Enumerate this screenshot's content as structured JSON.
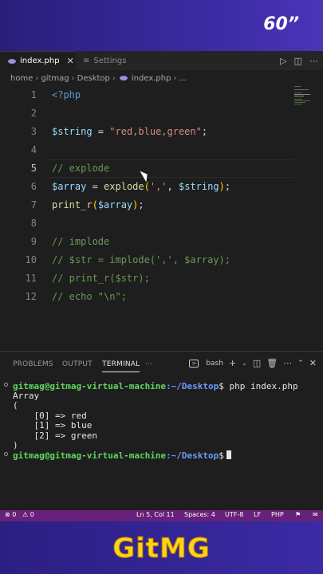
{
  "banner": {
    "badge": "60”"
  },
  "tabs": [
    {
      "label": "index.php",
      "close": "✕"
    },
    {
      "label": "Settings"
    }
  ],
  "breadcrumb": [
    "home",
    "gitmag",
    "Desktop",
    "index.php",
    "..."
  ],
  "editor": {
    "line_numbers": [
      "1",
      "2",
      "3",
      "4",
      "5",
      "6",
      "7",
      "8",
      "9",
      "10",
      "11",
      "12"
    ],
    "current_line": 5,
    "code": {
      "l1": "<?php",
      "l3_var": "$string",
      "l3_eq": " = ",
      "l3_str": "\"red,blue,green\"",
      "l3_end": ";",
      "l5": "// explode",
      "l6_var": "$array",
      "l6_eq": " = ",
      "l6_fn": "explode",
      "l6_open": "(",
      "l6_str": "','",
      "l6_comma": ", ",
      "l6_arg": "$string",
      "l6_close": ")",
      "l6_end": ";",
      "l7_fn": "print_r",
      "l7_open": "(",
      "l7_arg": "$array",
      "l7_close": ")",
      "l7_end": ";",
      "l9": "// implode",
      "l10": "// $str = implode(',', $array);",
      "l11": "// print_r($str);",
      "l12": "// echo \"\\n\";"
    }
  },
  "panel": {
    "tabs": [
      "PROBLEMS",
      "OUTPUT",
      "TERMINAL",
      "···"
    ],
    "active_tab": "TERMINAL",
    "shell": "bash"
  },
  "terminal": {
    "user": "gitmag@gitmag-virtual-machine",
    "path": ":~/Desktop",
    "prompt": "$",
    "command": " php index.php",
    "output": [
      "Array",
      "(",
      "    [0] => red",
      "    [1] => blue",
      "    [2] => green",
      ")"
    ]
  },
  "status": {
    "errors": "⊗ 0",
    "warnings": "⚠ 0",
    "position": "Ln 5, Col 11",
    "spaces": "Spaces: 4",
    "encoding": "UTF-8",
    "eol": "LF",
    "language": "PHP"
  },
  "logo": {
    "text": "GitMG"
  },
  "colors": {
    "accent": "#68217a",
    "brand_bg": "#3a2aa0",
    "logo": "#ffd21a"
  }
}
